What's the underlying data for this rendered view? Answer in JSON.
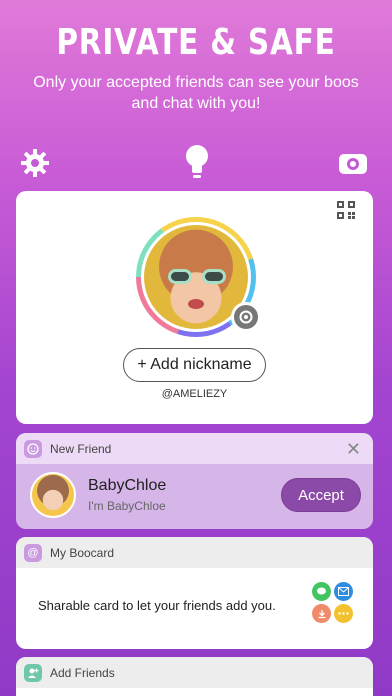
{
  "headline": "PRIVATE & SAFE",
  "subheadline": "Only your accepted friends can see your boos and chat with you!",
  "profile": {
    "nickname_button": "+ Add nickname",
    "handle": "@AMELIEZY"
  },
  "new_friend": {
    "section_title": "New Friend",
    "close": "✕",
    "name": "BabyChloe",
    "subtitle": "I'm BabyChloe",
    "accept_label": "Accept"
  },
  "boocard": {
    "section_title": "My Boocard",
    "description": "Sharable card to let your friends add you."
  },
  "add_friends": {
    "section_title": "Add Friends"
  },
  "colors": {
    "accent": "#8c4aa8",
    "share_green": "#43c463",
    "share_blue": "#2f8de0",
    "share_orange": "#f08a6a",
    "share_yellow": "#f2c12e"
  }
}
